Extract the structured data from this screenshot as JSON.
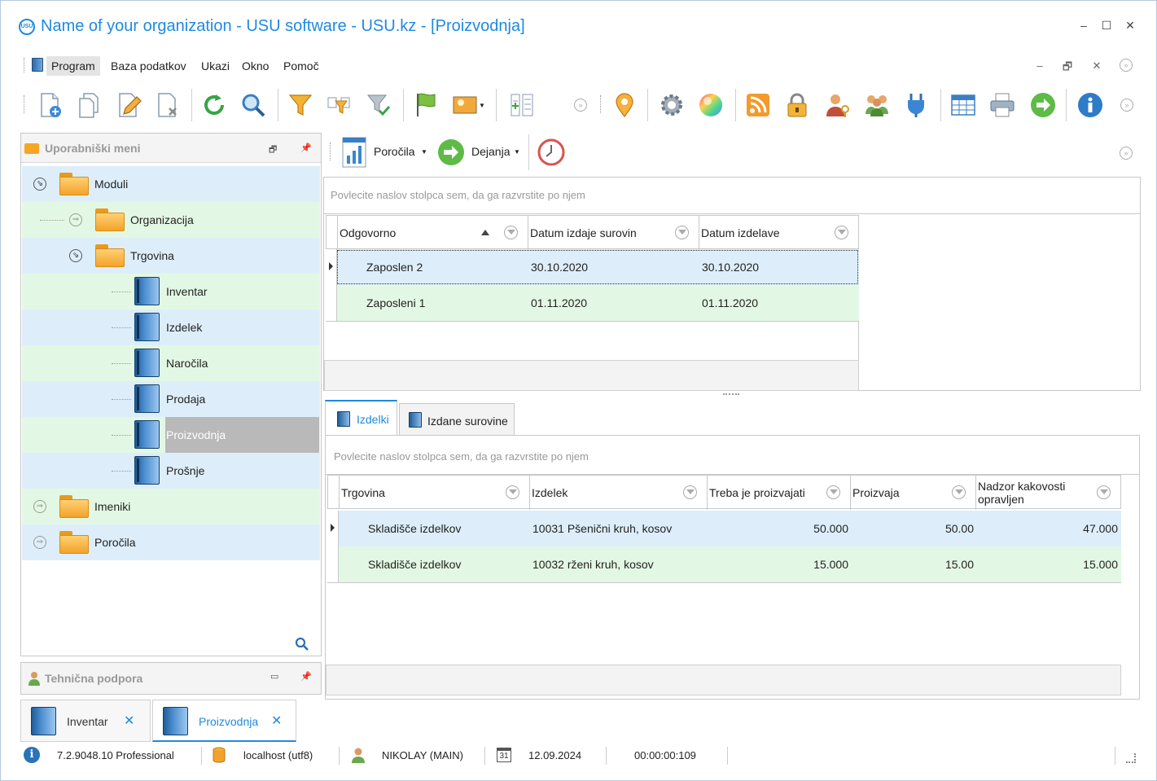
{
  "window": {
    "title": "Name of your organization - USU software - USU.kz - [Proizvodnja]",
    "logo_text": "USU",
    "controls": {
      "minimize": "–",
      "maximize": "☐",
      "close": "✕"
    }
  },
  "menubar": {
    "items": [
      {
        "label": "Program"
      },
      {
        "label": "Baza podatkov"
      },
      {
        "label": "Ukazi"
      },
      {
        "label": "Okno"
      },
      {
        "label": "Pomoč"
      }
    ],
    "mdi_controls": {
      "minimize": "–",
      "restore": "🗗",
      "close": "✕"
    }
  },
  "toolbar": {
    "icons": [
      "add-document-icon",
      "copy-document-icon",
      "edit-document-icon",
      "delete-document-icon",
      "refresh-icon",
      "search-icon",
      "filter-icon",
      "filter-edit-icon",
      "filter-apply-icon",
      "flag-icon",
      "image-icon",
      "columns-icon",
      "location-pin-icon",
      "settings-gear-icon",
      "color-wheel-icon",
      "rss-feed-icon",
      "lock-icon",
      "user-key-icon",
      "users-icon",
      "plug-icon",
      "table-icon",
      "printer-icon",
      "go-forward-icon",
      "info-icon"
    ]
  },
  "left_panel": {
    "title": "Uporabniški meni",
    "tree": [
      {
        "label": "Moduli"
      },
      {
        "label": "Organizacija"
      },
      {
        "label": "Trgovina"
      },
      {
        "label": "Inventar"
      },
      {
        "label": "Izdelek"
      },
      {
        "label": "Naročila"
      },
      {
        "label": "Prodaja"
      },
      {
        "label": "Proizvodnja"
      },
      {
        "label": "Prošnje"
      },
      {
        "label": "Imeniki"
      },
      {
        "label": "Poročila"
      }
    ]
  },
  "support_panel": {
    "title": "Tehnična podpora"
  },
  "right_toolbar": {
    "reports_label": "Poročila",
    "actions_label": "Dejanja"
  },
  "top_grid": {
    "group_hint": "Povlecite naslov stolpca sem, da ga razvrstite po njem",
    "columns": [
      "Odgovorno",
      "Datum izdaje surovin",
      "Datum izdelave"
    ],
    "rows": [
      [
        "Zaposlen 2",
        "30.10.2020",
        "30.10.2020"
      ],
      [
        "Zaposleni 1",
        "01.11.2020",
        "01.11.2020"
      ]
    ]
  },
  "tabs": [
    {
      "label": "Izdelki"
    },
    {
      "label": "Izdane surovine"
    }
  ],
  "bottom_grid": {
    "group_hint": "Povlecite naslov stolpca sem, da ga razvrstite po njem",
    "columns": [
      "Trgovina",
      "Izdelek",
      "Treba je proizvajati",
      "Proizvaja",
      "Nadzor kakovosti\nopravljen"
    ],
    "rows": [
      [
        "Skladišče izdelkov",
        "10031 Pšenični kruh, kosov",
        "50.000",
        "50.00",
        "47.000"
      ],
      [
        "Skladišče izdelkov",
        "10032 rženi kruh, kosov",
        "15.000",
        "15.00",
        "15.000"
      ]
    ]
  },
  "doc_tabs": [
    {
      "label": "Inventar",
      "close": "✕"
    },
    {
      "label": "Proizvodnja",
      "close": "✕"
    }
  ],
  "status": {
    "version": "7.2.9048.10 Professional",
    "server": "localhost (utf8)",
    "user": "NIKOLAY (MAIN)",
    "calendar_day": "31",
    "date": "12.09.2024",
    "timer": "00:00:00:109"
  },
  "colors": {
    "accent": "#1e8ae0",
    "row_blue": "#ddeefa",
    "row_green": "#e3f8e4",
    "selected_tree": "#b9b9b9"
  }
}
